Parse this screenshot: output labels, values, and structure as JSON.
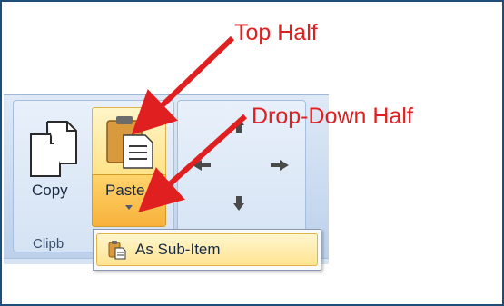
{
  "annotations": {
    "top_half": "Top Half",
    "drop_down_half": "Drop-Down Half"
  },
  "ribbon": {
    "copy_label": "Copy",
    "paste_label": "Paste",
    "group_label": "Clipb"
  },
  "dropdown_menu": {
    "item_label": "As Sub-Item"
  },
  "colors": {
    "annotation_red": "#e02020",
    "ribbon_blue": "#c9daf0",
    "highlight_yellow": "#ffe38a"
  }
}
